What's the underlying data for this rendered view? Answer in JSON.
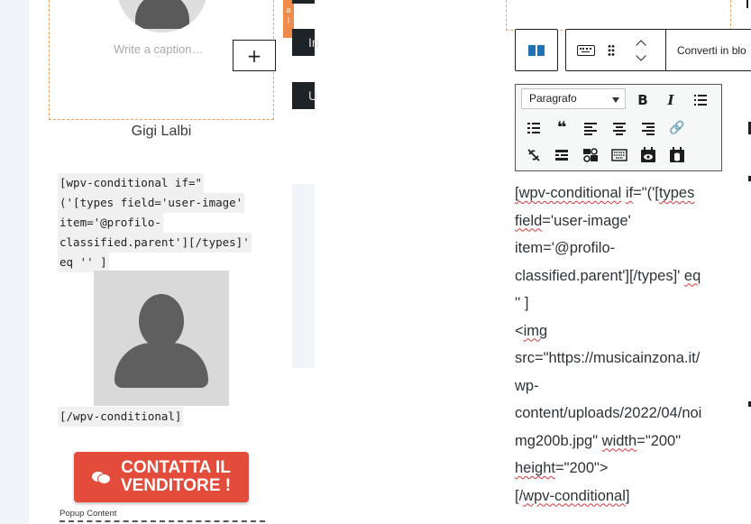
{
  "left": {
    "image_block": {
      "tab_letters": [
        "a",
        "l"
      ],
      "caption_placeholder": "Write a caption…",
      "add_label": "+"
    },
    "author_name": "Gigi Lalbi",
    "shortcode_lines": [
      "[wpv-conditional if=\"",
      "('[types field='user-image'",
      "item='@profilo-",
      "classified.parent'][/types]'",
      "eq '' ]"
    ],
    "shortcode_end": "[/wpv-conditional]",
    "cta_label_1": "CONTATTA IL",
    "cta_label_2": "VENDITORE !",
    "popup_label": "Popup Content"
  },
  "middle": {
    "bar1_text": "In",
    "bar2_text": "U"
  },
  "right": {
    "toolbar": {
      "convert_label": "Converti in blo"
    },
    "tinymce": {
      "format_select": "Paragrafo",
      "bold": "B",
      "italic": "I",
      "blockquote": "❝",
      "link": "🔗"
    },
    "editor_text": [
      "[wpv-conditional if=\"('[types",
      "field='user-image'",
      "item='@profilo-",
      "classified.parent'][/types]' eq",
      "'' ]",
      "<img",
      "src=\"https://musicainzona.it/",
      "wp-",
      "content/uploads/2022/04/noi",
      "mg200b.jpg\" width=\"200\"",
      "height=\"200\">",
      "[/wpv-conditional]"
    ]
  },
  "colors": {
    "accent_blue": "#2271b1",
    "cta_red": "#e34b3b",
    "dashed_orange": "#f0a060",
    "dark_bar": "#1d2327"
  }
}
